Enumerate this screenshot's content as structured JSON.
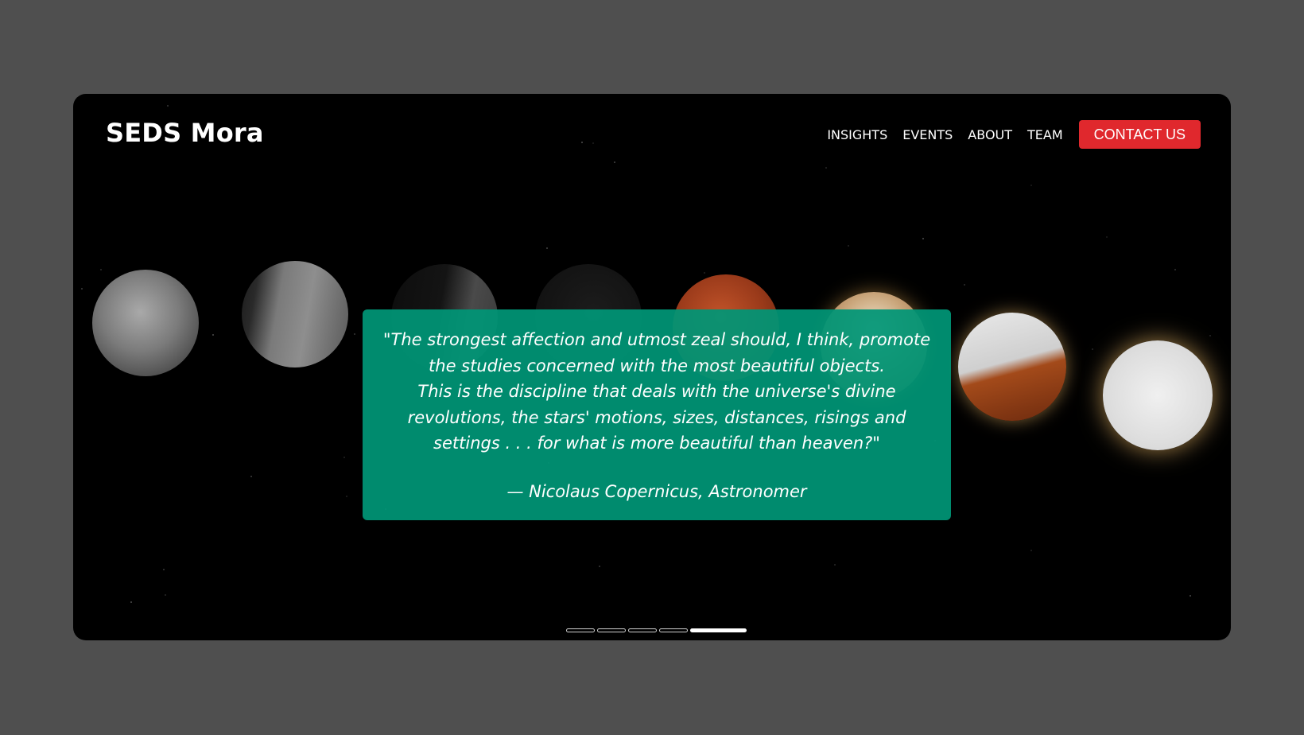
{
  "header": {
    "logo": "SEDS Mora",
    "nav": [
      "INSIGHTS",
      "EVENTS",
      "ABOUT",
      "TEAM"
    ],
    "contact_label": "CONTACT US"
  },
  "hero": {
    "quote": "\"The strongest affection and utmost zeal should, I think, promote the studies concerned with the most beautiful objects.\nThis is the discipline that deals with the universe's divine revolutions, the stars' motions, sizes, distances, risings and settings . . . for what is more beautiful than heaven?\"",
    "author": "— Nicolaus Copernicus, Astronomer"
  },
  "carousel": {
    "slides": 5,
    "active_index": 4
  },
  "colors": {
    "page_background": "#4f4f4f",
    "hero_background": "#000000",
    "quote_box": "#00967a",
    "contact_button": "#e0282d"
  }
}
